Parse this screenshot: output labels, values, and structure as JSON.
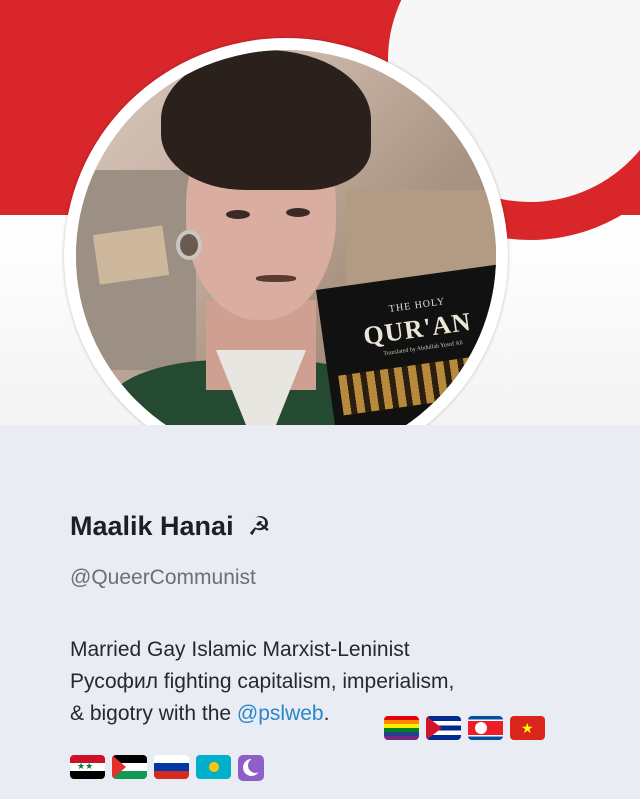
{
  "profile": {
    "name": "Maalik Hanai",
    "name_emoji": "☭",
    "handle": "@QueerCommunist",
    "bio_line1": "Married Gay Islamic Marxist-Leninist",
    "bio_line2": "Русофил fighting capitalism, imperialism,",
    "bio_line3_prefix": "& bigotry with the ",
    "bio_link": "@pslweb",
    "bio_suffix": ".",
    "book_title_top": "THE HOLY",
    "book_title": "QUR'AN",
    "book_subtitle": "Translated by Abdullah Yusuf Ali"
  },
  "colors": {
    "banner_red": "#d8262b",
    "link": "#2a86c8",
    "handle_gray": "#6b6f78",
    "background": "#e9ecf3"
  },
  "flags": [
    {
      "name": "rainbow-flag-icon"
    },
    {
      "name": "cuba-flag-icon"
    },
    {
      "name": "north-korea-flag-icon"
    },
    {
      "name": "vietnam-flag-icon"
    },
    {
      "name": "syria-flag-icon"
    },
    {
      "name": "palestine-flag-icon"
    },
    {
      "name": "russia-flag-icon"
    },
    {
      "name": "kazakhstan-flag-icon"
    },
    {
      "name": "crescent-moon-icon"
    }
  ]
}
